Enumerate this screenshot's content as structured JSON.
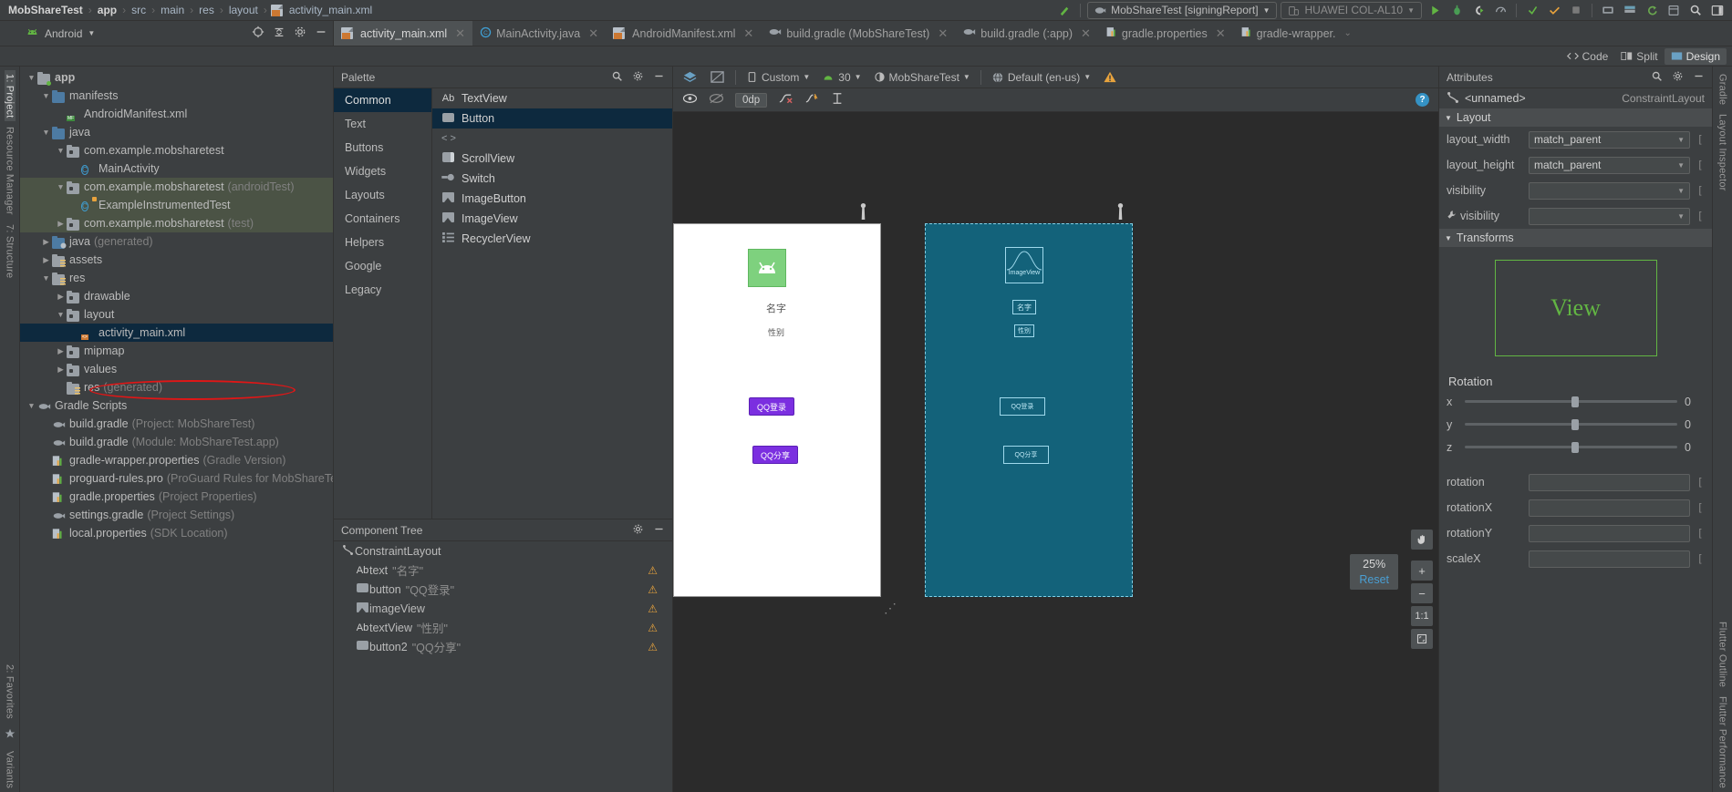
{
  "breadcrumb": {
    "items": [
      "MobShareTest",
      "app",
      "src",
      "main",
      "res",
      "layout",
      "activity_main.xml"
    ],
    "sep": "›"
  },
  "toolbar": {
    "build_hammer_icon": "hammer-icon",
    "run_config": "MobShareTest [signingReport]",
    "device": "HUAWEI COL-AL10",
    "run_icon": "run-icon",
    "debug_icon": "debug-icon",
    "attach_debugger_icon": "attach-debugger-icon",
    "profiler_icon": "profiler-icon",
    "apply_changes_icon": "apply-changes-icon",
    "stop_icon": "stop-icon",
    "avd_icon": "avd-manager-icon",
    "sdk_icon": "sdk-manager-icon",
    "sync_icon": "gradle-sync-icon",
    "search_icon": "search-icon",
    "layout_icon": "layout-inspector-icon"
  },
  "tabs": [
    {
      "label": "activity_main.xml",
      "icon": "xml-layout-icon",
      "active": true
    },
    {
      "label": "MainActivity.java",
      "icon": "java-class-icon",
      "active": false
    },
    {
      "label": "AndroidManifest.xml",
      "icon": "manifest-icon",
      "active": false
    },
    {
      "label": "build.gradle (MobShareTest)",
      "icon": "gradle-icon",
      "active": false
    },
    {
      "label": "build.gradle (:app)",
      "icon": "gradle-icon",
      "active": false
    },
    {
      "label": "gradle.properties",
      "icon": "properties-icon",
      "active": false
    },
    {
      "label": "gradle-wrapper.",
      "icon": "properties-icon",
      "active": false
    }
  ],
  "editor_modes": [
    {
      "label": "Code",
      "selected": false
    },
    {
      "label": "Split",
      "selected": false
    },
    {
      "label": "Design",
      "selected": true
    }
  ],
  "project": {
    "title": "Android",
    "tree": [
      {
        "indent": 0,
        "arrow": "down",
        "icon": "folder-module",
        "label": "app",
        "bold": true,
        "sub": ""
      },
      {
        "indent": 1,
        "arrow": "down",
        "icon": "folder-blue",
        "label": "manifests",
        "sub": ""
      },
      {
        "indent": 2,
        "arrow": "none",
        "icon": "file-manifest",
        "label": "AndroidManifest.xml",
        "sub": ""
      },
      {
        "indent": 1,
        "arrow": "down",
        "icon": "folder-blue",
        "label": "java",
        "sub": ""
      },
      {
        "indent": 2,
        "arrow": "down",
        "icon": "package",
        "label": "com.example.mobsharetest",
        "sub": ""
      },
      {
        "indent": 3,
        "arrow": "none",
        "icon": "class",
        "label": "MainActivity",
        "sub": ""
      },
      {
        "indent": 2,
        "arrow": "down",
        "icon": "package",
        "label": "com.example.mobsharetest",
        "sub": "(androidTest)",
        "row": "green"
      },
      {
        "indent": 3,
        "arrow": "none",
        "icon": "class-test",
        "label": "ExampleInstrumentedTest",
        "sub": "",
        "row": "green"
      },
      {
        "indent": 2,
        "arrow": "right",
        "icon": "package",
        "label": "com.example.mobsharetest",
        "sub": "(test)",
        "row": "green"
      },
      {
        "indent": 1,
        "arrow": "right",
        "icon": "folder-gen",
        "label": "java",
        "sub": "(generated)"
      },
      {
        "indent": 1,
        "arrow": "right",
        "icon": "folder-res",
        "label": "assets",
        "sub": ""
      },
      {
        "indent": 1,
        "arrow": "down",
        "icon": "folder-res",
        "label": "res",
        "sub": ""
      },
      {
        "indent": 2,
        "arrow": "right",
        "icon": "package",
        "label": "drawable",
        "sub": ""
      },
      {
        "indent": 2,
        "arrow": "down",
        "icon": "package",
        "label": "layout",
        "sub": ""
      },
      {
        "indent": 3,
        "arrow": "none",
        "icon": "file-xml",
        "label": "activity_main.xml",
        "sub": "",
        "row": "selected"
      },
      {
        "indent": 2,
        "arrow": "right",
        "icon": "package",
        "label": "mipmap",
        "sub": ""
      },
      {
        "indent": 2,
        "arrow": "right",
        "icon": "package",
        "label": "values",
        "sub": ""
      },
      {
        "indent": 2,
        "arrow": "none",
        "icon": "folder-res",
        "label": "res",
        "sub": "(generated)"
      },
      {
        "indent": 0,
        "arrow": "down",
        "icon": "gradle",
        "label": "Gradle Scripts",
        "sub": ""
      },
      {
        "indent": 1,
        "arrow": "none",
        "icon": "gradle",
        "label": "build.gradle",
        "sub": "(Project: MobShareTest)"
      },
      {
        "indent": 1,
        "arrow": "none",
        "icon": "gradle",
        "label": "build.gradle",
        "sub": "(Module: MobShareTest.app)"
      },
      {
        "indent": 1,
        "arrow": "none",
        "icon": "properties",
        "label": "gradle-wrapper.properties",
        "sub": "(Gradle Version)"
      },
      {
        "indent": 1,
        "arrow": "none",
        "icon": "properties",
        "label": "proguard-rules.pro",
        "sub": "(ProGuard Rules for MobShareTest.app)"
      },
      {
        "indent": 1,
        "arrow": "none",
        "icon": "properties",
        "label": "gradle.properties",
        "sub": "(Project Properties)"
      },
      {
        "indent": 1,
        "arrow": "none",
        "icon": "gradle",
        "label": "settings.gradle",
        "sub": "(Project Settings)"
      },
      {
        "indent": 1,
        "arrow": "none",
        "icon": "properties",
        "label": "local.properties",
        "sub": "(SDK Location)"
      }
    ]
  },
  "palette": {
    "title": "Palette",
    "categories": [
      {
        "label": "Common",
        "selected": true
      },
      {
        "label": "Text",
        "selected": false
      },
      {
        "label": "Buttons",
        "selected": false
      },
      {
        "label": "Widgets",
        "selected": false
      },
      {
        "label": "Layouts",
        "selected": false
      },
      {
        "label": "Containers",
        "selected": false
      },
      {
        "label": "Helpers",
        "selected": false
      },
      {
        "label": "Google",
        "selected": false
      },
      {
        "label": "Legacy",
        "selected": false
      }
    ],
    "items": [
      {
        "label": "TextView",
        "icon": "Ab",
        "selected": false
      },
      {
        "label": "Button",
        "icon": "button-icon",
        "selected": true
      },
      {
        "label": "<fragment>",
        "icon": "fragment-icon",
        "selected": false
      },
      {
        "label": "ScrollView",
        "icon": "scrollview-icon",
        "selected": false
      },
      {
        "label": "Switch",
        "icon": "switch-icon",
        "selected": false
      },
      {
        "label": "ImageButton",
        "icon": "imagebutton-icon",
        "selected": false
      },
      {
        "label": "ImageView",
        "icon": "imageview-icon",
        "selected": false
      },
      {
        "label": "RecyclerView",
        "icon": "recyclerview-icon",
        "selected": false
      }
    ]
  },
  "component_tree": {
    "title": "Component Tree",
    "rows": [
      {
        "indent": 0,
        "icon": "constraintlayout-icon",
        "label": "ConstraintLayout",
        "value": "",
        "warn": false
      },
      {
        "indent": 1,
        "icon": "Ab",
        "label": "text",
        "value": "\"名字\"",
        "warn": true
      },
      {
        "indent": 1,
        "icon": "button-icon",
        "label": "button",
        "value": "\"QQ登录\"",
        "warn": true
      },
      {
        "indent": 1,
        "icon": "imageview-icon",
        "label": "imageView",
        "value": "",
        "warn": true
      },
      {
        "indent": 1,
        "icon": "Ab",
        "label": "textView",
        "value": "\"性别\"",
        "warn": true
      },
      {
        "indent": 1,
        "icon": "button-icon",
        "label": "button2",
        "value": "\"QQ分享\"",
        "warn": true
      }
    ]
  },
  "design_toolbar": {
    "layers_icon": "layers-icon",
    "blueprint_icon": "blueprint-toggle-icon",
    "orientation": "Custom",
    "api_level": "30",
    "theme": "MobShareTest",
    "locale": "Default (en-us)",
    "warning_icon": "warning-icon"
  },
  "design_toolbar2": {
    "eye_icon": "show-constraints-icon",
    "magnet_icon": "autoconnect-icon",
    "margin_value": "0dp",
    "clear_constraints_icon": "clear-constraints-icon",
    "infer_icon": "infer-constraints-icon",
    "guideline_icon": "guidelines-icon",
    "help_icon": "help-icon"
  },
  "canvas": {
    "zoom_percent": "25%",
    "reset_label": "Reset",
    "pan_icon": "pan-icon",
    "zoom_in_icon": "+",
    "zoom_out_icon": "−",
    "zoom_actual": "1:1",
    "zoom_fit_icon": "zoom-to-fit-icon",
    "design_widgets": [
      {
        "name": "imageView",
        "type": "image",
        "label": ""
      },
      {
        "name": "text",
        "type": "text",
        "label": "名字"
      },
      {
        "name": "textView",
        "type": "text",
        "label": "性别"
      },
      {
        "name": "button",
        "type": "button",
        "label": "QQ登录"
      },
      {
        "name": "button2",
        "type": "button",
        "label": "QQ分享"
      }
    ],
    "blueprint_widgets": [
      {
        "name": "imageView",
        "label": "ImageView"
      },
      {
        "name": "text",
        "label": "名字"
      },
      {
        "name": "textView",
        "label": "性别"
      },
      {
        "name": "button",
        "label": "QQ登录"
      },
      {
        "name": "button2",
        "label": "QQ分享"
      }
    ]
  },
  "attributes": {
    "title": "Attributes",
    "selected_id": "<unnamed>",
    "selected_type": "ConstraintLayout",
    "sections": [
      {
        "title": "Layout",
        "rows": [
          {
            "label": "layout_width",
            "value": "match_parent",
            "type": "dropdown"
          },
          {
            "label": "layout_height",
            "value": "match_parent",
            "type": "dropdown"
          },
          {
            "label": "visibility",
            "value": "",
            "type": "dropdown"
          },
          {
            "label": "visibility",
            "value": "",
            "type": "dropdown",
            "tool": true
          }
        ]
      },
      {
        "title": "Transforms",
        "rows": []
      }
    ],
    "view_preview_label": "View",
    "rotation_title": "Rotation",
    "rotation_axes": [
      {
        "axis": "x",
        "value": "0"
      },
      {
        "axis": "y",
        "value": "0"
      },
      {
        "axis": "z",
        "value": "0"
      }
    ],
    "transform_rows": [
      {
        "label": "rotation",
        "value": ""
      },
      {
        "label": "rotationX",
        "value": ""
      },
      {
        "label": "rotationY",
        "value": ""
      },
      {
        "label": "scaleX",
        "value": ""
      }
    ]
  },
  "left_strip": [
    {
      "label": "1: Project",
      "selected": true
    },
    {
      "label": "Resource Manager",
      "selected": false
    },
    {
      "label": "7: Structure",
      "selected": false
    },
    {
      "label": "2: Favorites",
      "selected": false
    },
    {
      "label": "Variants",
      "selected": false
    }
  ],
  "right_strip": [
    {
      "label": "Gradle",
      "selected": false
    },
    {
      "label": "Layout Inspector",
      "selected": false
    },
    {
      "label": "Flutter Outline",
      "selected": false
    },
    {
      "label": "Flutter Performance",
      "selected": false
    }
  ]
}
